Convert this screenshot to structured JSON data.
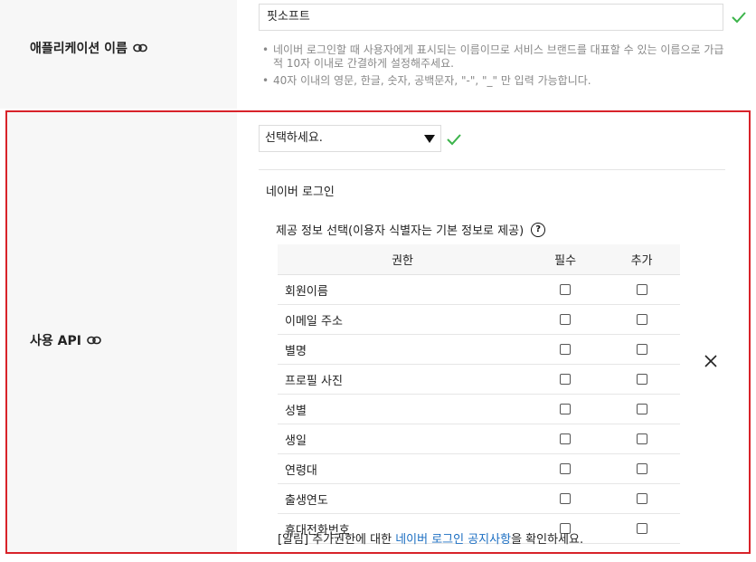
{
  "app_name": {
    "label": "애플리케이션 이름",
    "value": "핏소프트",
    "help": [
      "네이버 로그인할 때 사용자에게 표시되는 이름이므로 서비스 브랜드를 대표할 수 있는 이름으로 가급적 10자 이내로 간결하게 설정해주세요.",
      "40자 이내의 영문, 한글, 숫자, 공백문자, \"-\", \"_\" 만 입력 가능합니다."
    ]
  },
  "api": {
    "label": "사용 API",
    "select_value": "선택하세요.",
    "provider_title": "네이버 로그인",
    "info_title": "제공 정보 선택(이용자 식별자는 기본 정보로 제공)",
    "help_glyph": "?",
    "table": {
      "headers": [
        "권한",
        "필수",
        "추가"
      ],
      "rows": [
        {
          "name": "회원이름",
          "required": false,
          "additional": false
        },
        {
          "name": "이메일 주소",
          "required": false,
          "additional": false
        },
        {
          "name": "별명",
          "required": false,
          "additional": false
        },
        {
          "name": "프로필 사진",
          "required": false,
          "additional": false
        },
        {
          "name": "성별",
          "required": false,
          "additional": false
        },
        {
          "name": "생일",
          "required": false,
          "additional": false
        },
        {
          "name": "연령대",
          "required": false,
          "additional": false
        },
        {
          "name": "출생연도",
          "required": false,
          "additional": false
        },
        {
          "name": "휴대전화번호",
          "required": false,
          "additional": false
        }
      ]
    },
    "notice": {
      "prefix": "[알림] 추가권한에 대한 ",
      "link": "네이버 로그인 공지사항",
      "suffix": "을 확인하세요."
    }
  },
  "colors": {
    "highlight_border": "#d8232a",
    "check_green": "#3cb44b",
    "link_blue": "#1b6ec2"
  },
  "icons": [
    "link-icon",
    "check-icon",
    "chevron-down-icon",
    "help-icon",
    "close-icon"
  ]
}
